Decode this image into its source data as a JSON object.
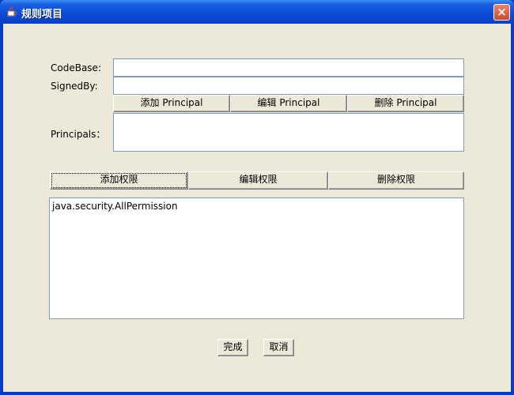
{
  "window": {
    "title": "规则项目",
    "close_label": "×"
  },
  "form": {
    "codebase_label": "CodeBase:",
    "codebase_value": "",
    "signedby_label": "SignedBy:",
    "signedby_value": "",
    "principals_label": "Principals：",
    "principal_buttons": {
      "add": "添加 Principal",
      "edit": "编辑 Principal",
      "remove": "删除 Principal"
    }
  },
  "permissions": {
    "buttons": {
      "add": "添加权限",
      "edit": "编辑权限",
      "remove": "删除权限"
    },
    "items": [
      "java.security.AllPermission"
    ]
  },
  "footer": {
    "ok": "完成",
    "cancel": "取消"
  },
  "colors": {
    "title_bar": "#0a4ad6",
    "client_bg": "#ece9d8",
    "field_border": "#7f9db9"
  },
  "icons": {
    "app": "java-cup-icon",
    "close": "close-icon"
  }
}
